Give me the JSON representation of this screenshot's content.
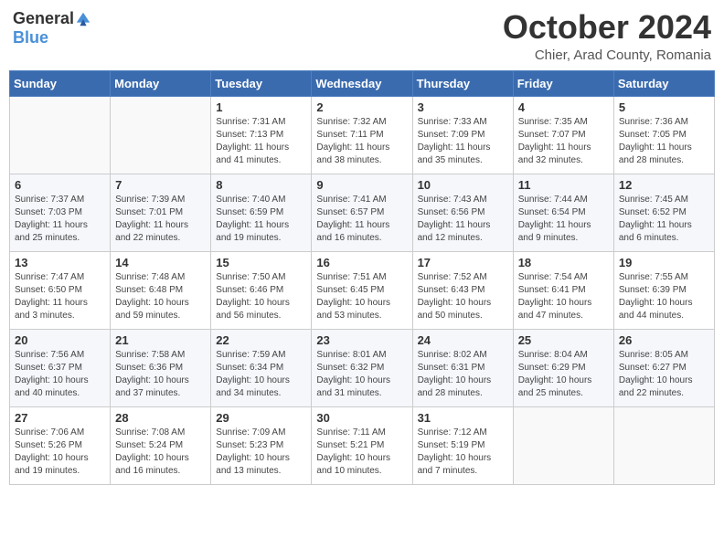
{
  "header": {
    "logo_general": "General",
    "logo_blue": "Blue",
    "month_title": "October 2024",
    "location": "Chier, Arad County, Romania"
  },
  "days_of_week": [
    "Sunday",
    "Monday",
    "Tuesday",
    "Wednesday",
    "Thursday",
    "Friday",
    "Saturday"
  ],
  "weeks": [
    [
      {
        "day": "",
        "info": ""
      },
      {
        "day": "",
        "info": ""
      },
      {
        "day": "1",
        "info": "Sunrise: 7:31 AM\nSunset: 7:13 PM\nDaylight: 11 hours and 41 minutes."
      },
      {
        "day": "2",
        "info": "Sunrise: 7:32 AM\nSunset: 7:11 PM\nDaylight: 11 hours and 38 minutes."
      },
      {
        "day": "3",
        "info": "Sunrise: 7:33 AM\nSunset: 7:09 PM\nDaylight: 11 hours and 35 minutes."
      },
      {
        "day": "4",
        "info": "Sunrise: 7:35 AM\nSunset: 7:07 PM\nDaylight: 11 hours and 32 minutes."
      },
      {
        "day": "5",
        "info": "Sunrise: 7:36 AM\nSunset: 7:05 PM\nDaylight: 11 hours and 28 minutes."
      }
    ],
    [
      {
        "day": "6",
        "info": "Sunrise: 7:37 AM\nSunset: 7:03 PM\nDaylight: 11 hours and 25 minutes."
      },
      {
        "day": "7",
        "info": "Sunrise: 7:39 AM\nSunset: 7:01 PM\nDaylight: 11 hours and 22 minutes."
      },
      {
        "day": "8",
        "info": "Sunrise: 7:40 AM\nSunset: 6:59 PM\nDaylight: 11 hours and 19 minutes."
      },
      {
        "day": "9",
        "info": "Sunrise: 7:41 AM\nSunset: 6:57 PM\nDaylight: 11 hours and 16 minutes."
      },
      {
        "day": "10",
        "info": "Sunrise: 7:43 AM\nSunset: 6:56 PM\nDaylight: 11 hours and 12 minutes."
      },
      {
        "day": "11",
        "info": "Sunrise: 7:44 AM\nSunset: 6:54 PM\nDaylight: 11 hours and 9 minutes."
      },
      {
        "day": "12",
        "info": "Sunrise: 7:45 AM\nSunset: 6:52 PM\nDaylight: 11 hours and 6 minutes."
      }
    ],
    [
      {
        "day": "13",
        "info": "Sunrise: 7:47 AM\nSunset: 6:50 PM\nDaylight: 11 hours and 3 minutes."
      },
      {
        "day": "14",
        "info": "Sunrise: 7:48 AM\nSunset: 6:48 PM\nDaylight: 10 hours and 59 minutes."
      },
      {
        "day": "15",
        "info": "Sunrise: 7:50 AM\nSunset: 6:46 PM\nDaylight: 10 hours and 56 minutes."
      },
      {
        "day": "16",
        "info": "Sunrise: 7:51 AM\nSunset: 6:45 PM\nDaylight: 10 hours and 53 minutes."
      },
      {
        "day": "17",
        "info": "Sunrise: 7:52 AM\nSunset: 6:43 PM\nDaylight: 10 hours and 50 minutes."
      },
      {
        "day": "18",
        "info": "Sunrise: 7:54 AM\nSunset: 6:41 PM\nDaylight: 10 hours and 47 minutes."
      },
      {
        "day": "19",
        "info": "Sunrise: 7:55 AM\nSunset: 6:39 PM\nDaylight: 10 hours and 44 minutes."
      }
    ],
    [
      {
        "day": "20",
        "info": "Sunrise: 7:56 AM\nSunset: 6:37 PM\nDaylight: 10 hours and 40 minutes."
      },
      {
        "day": "21",
        "info": "Sunrise: 7:58 AM\nSunset: 6:36 PM\nDaylight: 10 hours and 37 minutes."
      },
      {
        "day": "22",
        "info": "Sunrise: 7:59 AM\nSunset: 6:34 PM\nDaylight: 10 hours and 34 minutes."
      },
      {
        "day": "23",
        "info": "Sunrise: 8:01 AM\nSunset: 6:32 PM\nDaylight: 10 hours and 31 minutes."
      },
      {
        "day": "24",
        "info": "Sunrise: 8:02 AM\nSunset: 6:31 PM\nDaylight: 10 hours and 28 minutes."
      },
      {
        "day": "25",
        "info": "Sunrise: 8:04 AM\nSunset: 6:29 PM\nDaylight: 10 hours and 25 minutes."
      },
      {
        "day": "26",
        "info": "Sunrise: 8:05 AM\nSunset: 6:27 PM\nDaylight: 10 hours and 22 minutes."
      }
    ],
    [
      {
        "day": "27",
        "info": "Sunrise: 7:06 AM\nSunset: 5:26 PM\nDaylight: 10 hours and 19 minutes."
      },
      {
        "day": "28",
        "info": "Sunrise: 7:08 AM\nSunset: 5:24 PM\nDaylight: 10 hours and 16 minutes."
      },
      {
        "day": "29",
        "info": "Sunrise: 7:09 AM\nSunset: 5:23 PM\nDaylight: 10 hours and 13 minutes."
      },
      {
        "day": "30",
        "info": "Sunrise: 7:11 AM\nSunset: 5:21 PM\nDaylight: 10 hours and 10 minutes."
      },
      {
        "day": "31",
        "info": "Sunrise: 7:12 AM\nSunset: 5:19 PM\nDaylight: 10 hours and 7 minutes."
      },
      {
        "day": "",
        "info": ""
      },
      {
        "day": "",
        "info": ""
      }
    ]
  ]
}
